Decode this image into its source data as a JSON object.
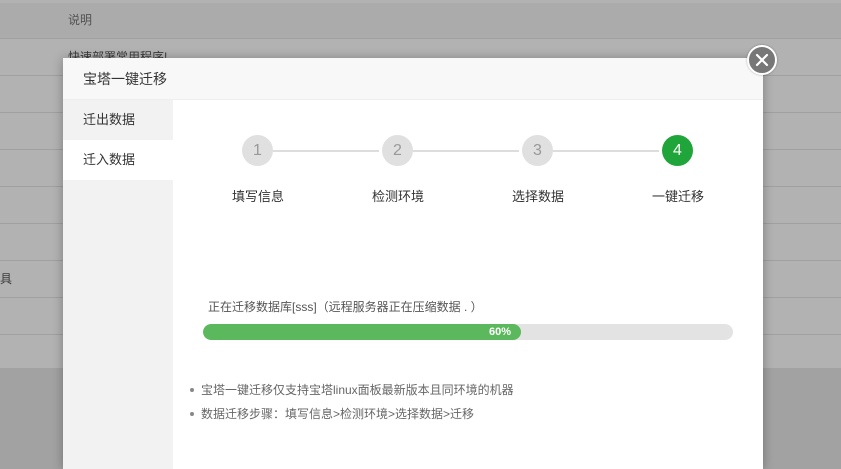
{
  "background": {
    "header_label": "说明",
    "row_text": "快速部署常用程序!",
    "left_text": "具"
  },
  "modal": {
    "title": "宝塔一键迁移",
    "close_icon": "close-icon",
    "sidebar": [
      {
        "label": "迁出数据"
      },
      {
        "label": "迁入数据"
      }
    ],
    "steps": [
      {
        "number": "1",
        "label": "填写信息"
      },
      {
        "number": "2",
        "label": "检测环境"
      },
      {
        "number": "3",
        "label": "选择数据"
      },
      {
        "number": "4",
        "label": "一键迁移"
      }
    ],
    "active_step": 4,
    "status_text": "正在迁移数据库[sss]（远程服务器正在压缩数据 .  ）",
    "progress": {
      "percent": 60,
      "label": "60%"
    },
    "notes": [
      "宝塔一键迁移仅支持宝塔linux面板最新版本且同环境的机器",
      "数据迁移步骤：填写信息>检测环境>选择数据>迁移"
    ]
  },
  "colors": {
    "accent": "#20a53a",
    "progress": "#5cb85c"
  }
}
